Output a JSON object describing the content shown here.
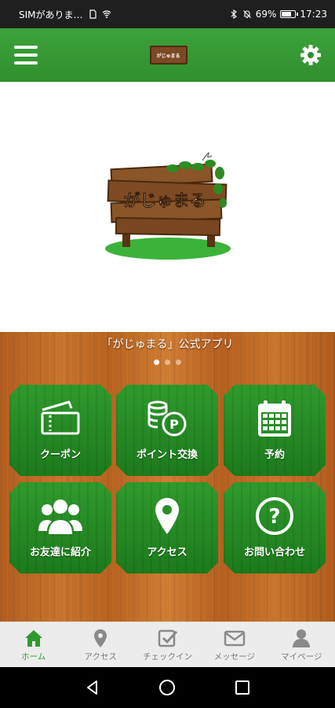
{
  "status_bar": {
    "carrier": "SIMがありま…",
    "battery_percent": "69%",
    "time": "17:23"
  },
  "header": {
    "logo_text": "がじゅまる"
  },
  "hero": {
    "sign_text": "がじゅまる"
  },
  "banner": {
    "app_title": "「がじゅまる」公式アプリ",
    "slide_count": 3,
    "active_slide": 0
  },
  "tiles": [
    {
      "label": "クーポン",
      "icon": "ticket-icon"
    },
    {
      "label": "ポイント交換",
      "icon": "coins-points-icon"
    },
    {
      "label": "予約",
      "icon": "calendar-icon"
    },
    {
      "label": "お友達に紹介",
      "icon": "people-icon"
    },
    {
      "label": "アクセス",
      "icon": "map-pin-icon"
    },
    {
      "label": "お問い合わせ",
      "icon": "question-icon"
    }
  ],
  "bottom_nav": [
    {
      "label": "ホーム",
      "icon": "home-icon",
      "active": true
    },
    {
      "label": "アクセス",
      "icon": "map-pin-icon",
      "active": false
    },
    {
      "label": "チェックイン",
      "icon": "checkbox-icon",
      "active": false
    },
    {
      "label": "メッセージ",
      "icon": "envelope-icon",
      "active": false
    },
    {
      "label": "マイページ",
      "icon": "person-icon",
      "active": false
    }
  ],
  "colors": {
    "accent_green": "#2f9a2d",
    "wood_brown": "#c06a25"
  }
}
